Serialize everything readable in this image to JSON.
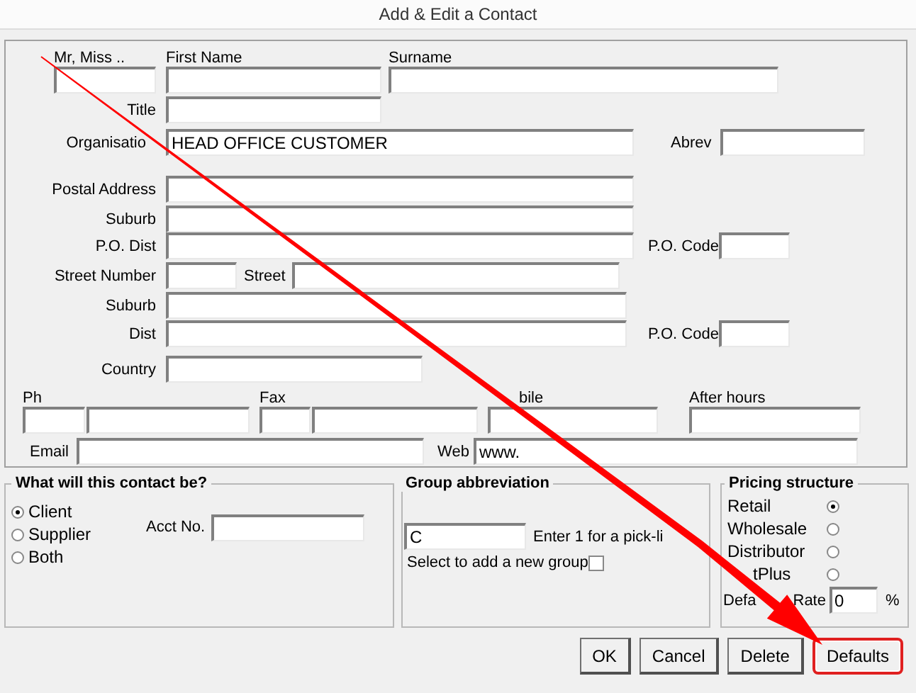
{
  "window": {
    "title": "Add & Edit a Contact"
  },
  "contact": {
    "salutation": {
      "label": "Mr, Miss .."
    },
    "first_name": {
      "label": "First Name"
    },
    "surname": {
      "label": "Surname"
    },
    "title": {
      "label": "Title"
    },
    "organisation": {
      "label": "Organisatio",
      "value": "HEAD OFFICE CUSTOMER"
    },
    "abrev": {
      "label": "Abrev"
    }
  },
  "postal": {
    "address": {
      "label": "Postal Address"
    },
    "suburb": {
      "label": "Suburb"
    },
    "po_dist": {
      "label": "P.O. Dist"
    },
    "po_code": {
      "label": "P.O. Code"
    }
  },
  "street": {
    "number": {
      "label": "Street Number"
    },
    "street": {
      "label": "Street"
    },
    "suburb": {
      "label": "Suburb"
    },
    "dist": {
      "label": "Dist"
    },
    "po_code": {
      "label": "P.O. Code"
    },
    "country": {
      "label": "Country"
    }
  },
  "phones": {
    "ph": {
      "label": "Ph"
    },
    "fax": {
      "label": "Fax"
    },
    "mobile": {
      "label": "bile"
    },
    "after_hours": {
      "label": "After hours"
    }
  },
  "email": {
    "label": "Email"
  },
  "web": {
    "label": "Web",
    "value": "www."
  },
  "contact_type": {
    "title": "What will this contact be?",
    "options": [
      {
        "label": "Client",
        "selected": true
      },
      {
        "label": "Supplier",
        "selected": false
      },
      {
        "label": "Both",
        "selected": false
      }
    ],
    "acct_no": {
      "label": "Acct No."
    }
  },
  "group": {
    "title": "Group abbreviation",
    "value": "C",
    "hint": "Enter 1 for a pick-li",
    "new_group": {
      "label": "Select to add a new group",
      "checked": false
    }
  },
  "pricing": {
    "title": "Pricing structure",
    "options": [
      {
        "label": "Retail",
        "selected": true
      },
      {
        "label": "Wholesale",
        "selected": false
      },
      {
        "label": "Distributor",
        "selected": false
      },
      {
        "label": "tPlus",
        "selected": false
      }
    ],
    "default_rate": {
      "label_parts": [
        "Defa",
        "Rate"
      ],
      "value": "0",
      "unit": "%"
    }
  },
  "buttons": [
    {
      "label": "OK",
      "highlighted": false
    },
    {
      "label": "Cancel",
      "highlighted": false
    },
    {
      "label": "Delete",
      "highlighted": false
    },
    {
      "label": "Defaults",
      "highlighted": true
    }
  ]
}
